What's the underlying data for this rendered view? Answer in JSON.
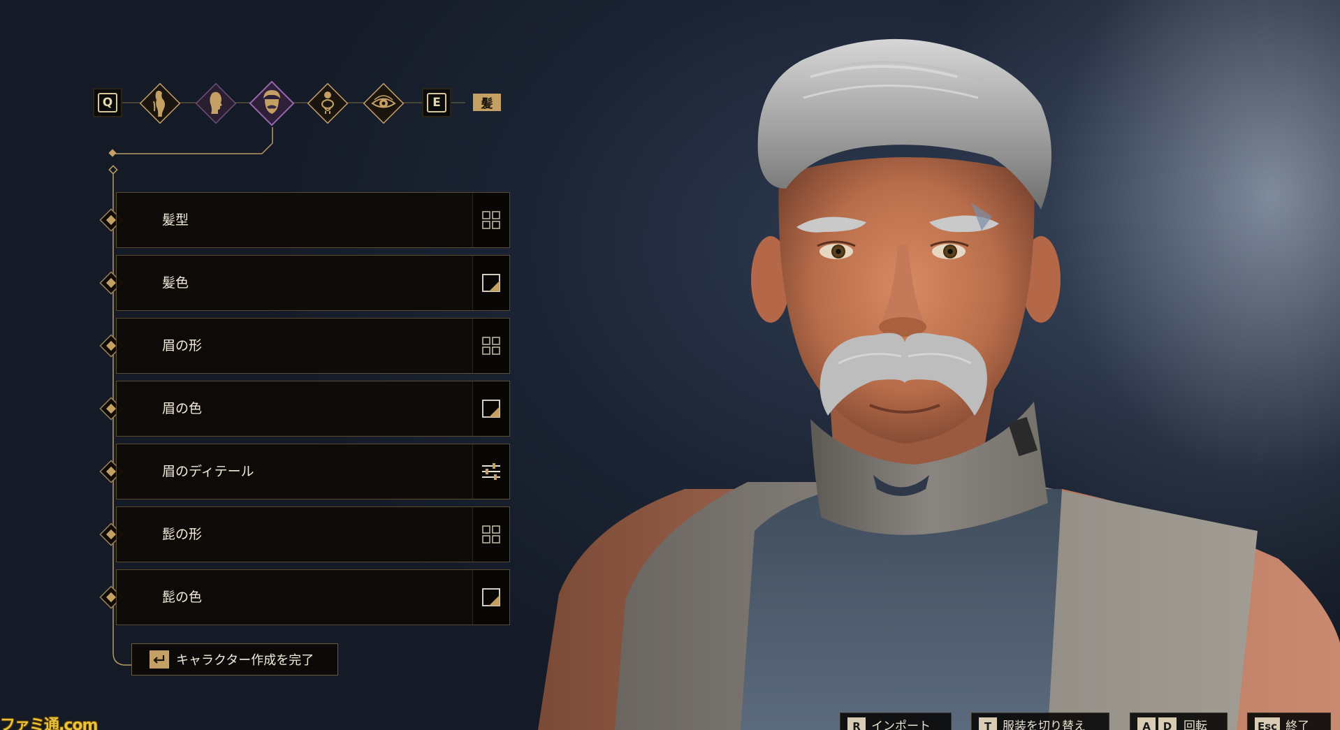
{
  "top_bar": {
    "prev_key": "Q",
    "next_key": "E",
    "section_label": "髪",
    "categories": [
      {
        "icon": "body-silhouette-icon",
        "active": false
      },
      {
        "icon": "head-profile-icon",
        "active": false
      },
      {
        "icon": "face-hair-icon",
        "active": true
      },
      {
        "icon": "knot-ornament-icon",
        "active": false
      },
      {
        "icon": "eye-icon",
        "active": false
      }
    ]
  },
  "options": [
    {
      "label": "髪型",
      "icon": "grid-icon"
    },
    {
      "label": "髪色",
      "icon": "color-swatch-icon"
    },
    {
      "label": "眉の形",
      "icon": "grid-icon"
    },
    {
      "label": "眉の色",
      "icon": "color-swatch-icon"
    },
    {
      "label": "眉のディテール",
      "icon": "sliders-icon"
    },
    {
      "label": "髭の形",
      "icon": "grid-icon"
    },
    {
      "label": "髭の色",
      "icon": "color-swatch-icon"
    }
  ],
  "finish": {
    "label": "キャラクター作成を完了",
    "key_icon": "enter-icon"
  },
  "hints": [
    {
      "key": "R",
      "label": "インポート"
    },
    {
      "key": "T",
      "label": "服装を切り替え"
    },
    {
      "key1": "A",
      "key2": "D",
      "label": "回転"
    },
    {
      "key": "Esc",
      "label": "終了"
    }
  ],
  "watermark": "ファミ通.com",
  "colors": {
    "gold": "#c4a064",
    "active_purple": "#7a4a8a",
    "row_bg": "#0e0a06",
    "text": "#f2ebdc"
  }
}
